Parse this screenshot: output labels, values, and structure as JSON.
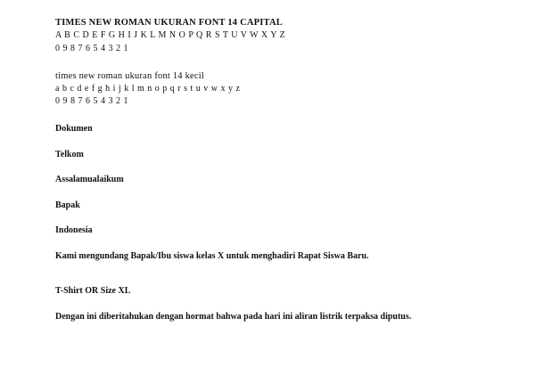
{
  "document": {
    "capital_section": {
      "heading": "TIMES NEW ROMAN UKURAN FONT 14 CAPITAL",
      "alphabet": "A B C D E F G H I J K L M N O P Q R S T U V W X Y Z",
      "digits": "0 9 8 7 6 5 4 3 2 1"
    },
    "small_section": {
      "heading": "times new roman ukuran font 14 kecil",
      "alphabet": "a b c d e f g h i j k l m n o p q r s t u v w x y z",
      "digits": "0 9 8 7 6 5 4 3 2 1"
    },
    "words": [
      "Dokumen",
      "Telkom",
      "Assalamualaikum",
      "Bapak",
      "Indonesia"
    ],
    "paragraph_1": "Kami mengundang Bapak/Ibu siswa kelas X untuk menghadiri Rapat Siswa Baru.",
    "shirt_size": "T-Shirt OR Size XL",
    "paragraph_2": "Dengan ini diberitahukan dengan hormat bahwa pada hari ini aliran listrik terpaksa diputus."
  }
}
